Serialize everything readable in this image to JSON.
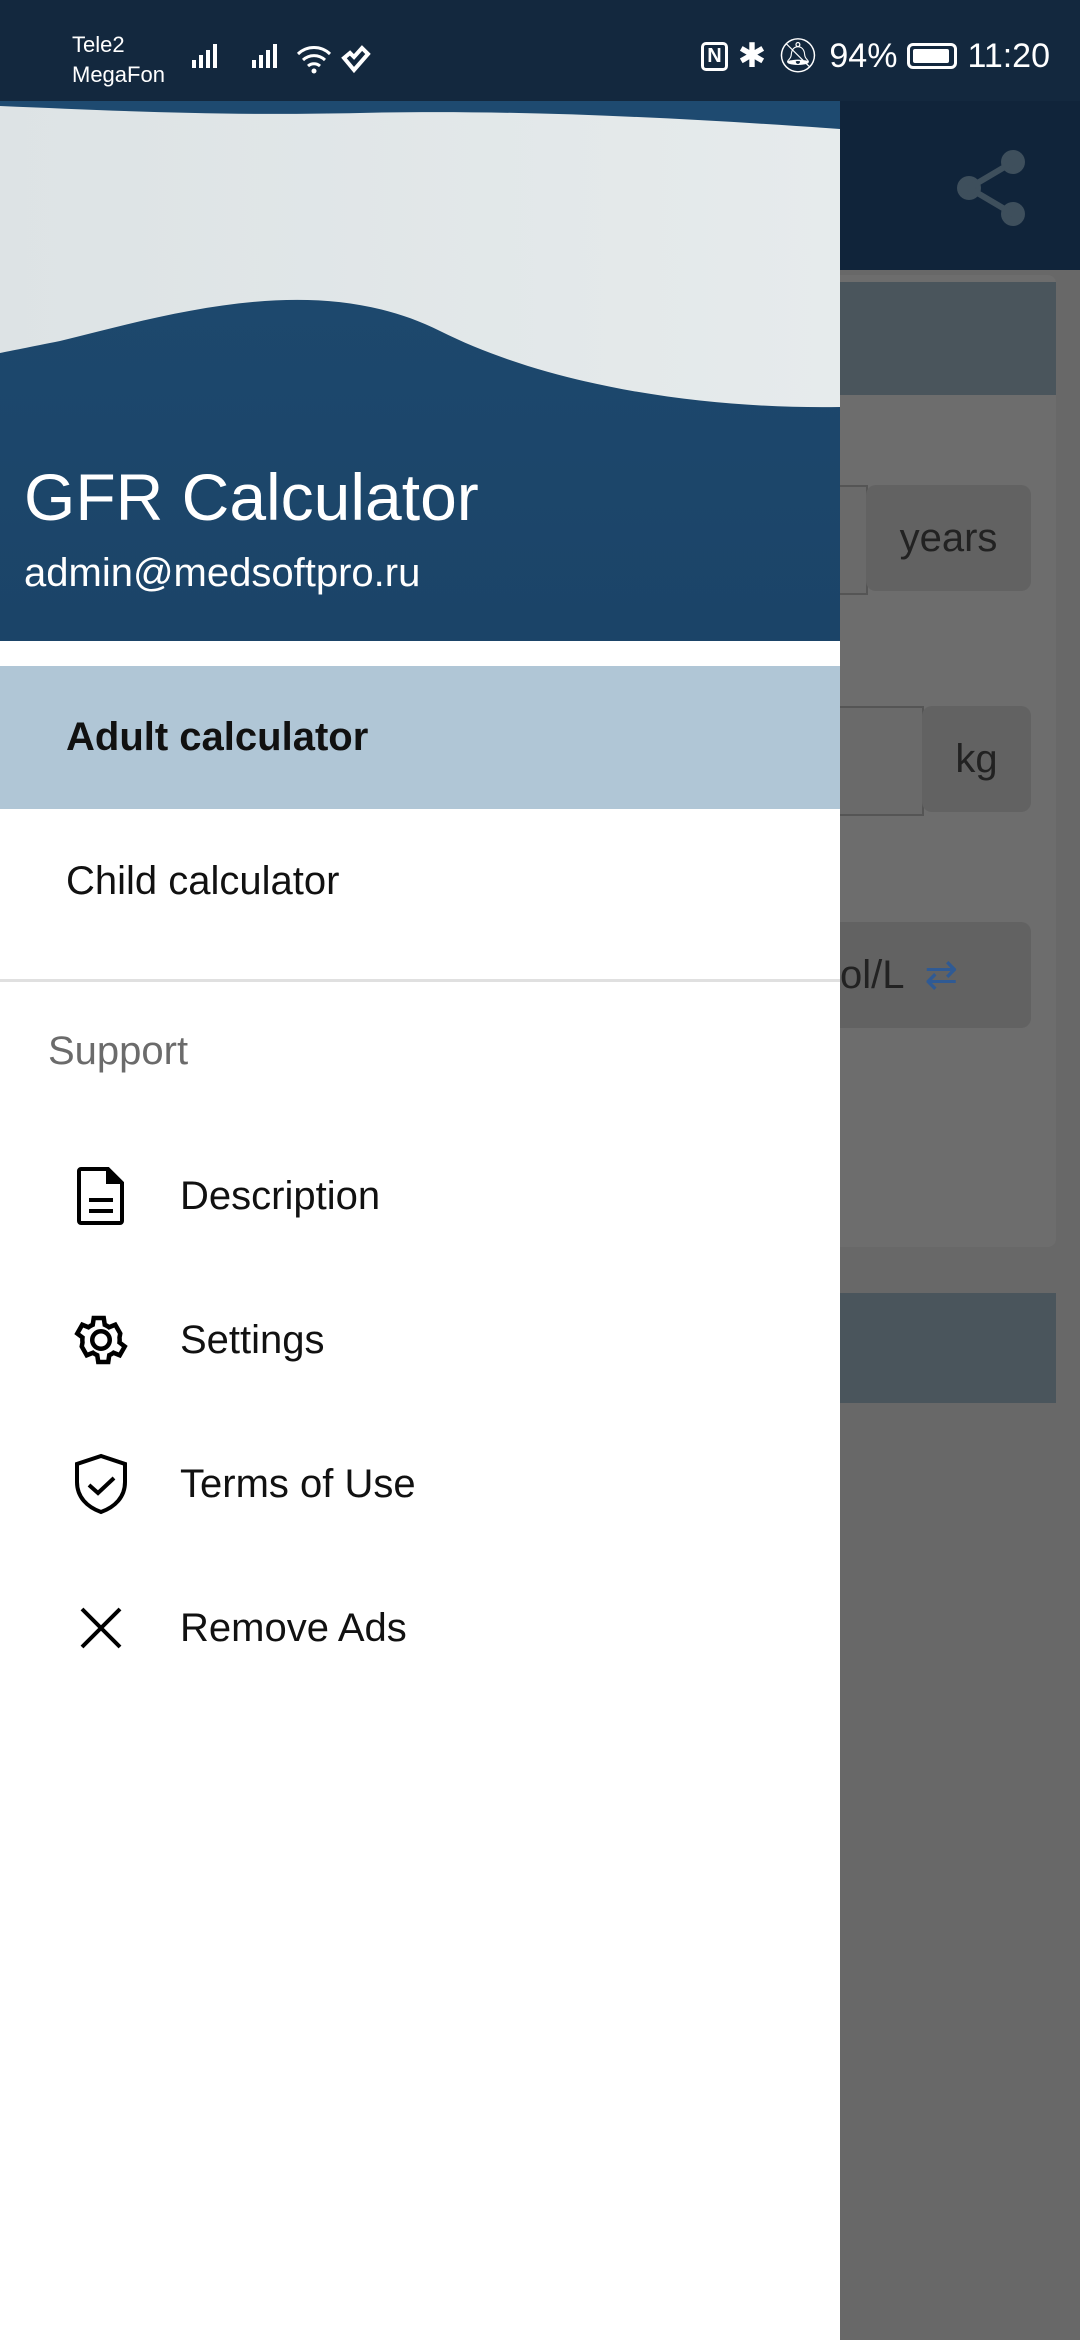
{
  "status_bar": {
    "carrier1": "Tele2",
    "carrier2": "MegaFon",
    "battery": "94%",
    "time": "11:20"
  },
  "background_app": {
    "units": [
      "years",
      "kg",
      "ol/L"
    ],
    "accent": "#2f5a94"
  },
  "drawer": {
    "title": "GFR Calculator",
    "email": "admin@medsoftpro.ru",
    "items": [
      {
        "label": "Adult calculator",
        "selected": true
      },
      {
        "label": "Child calculator",
        "selected": false
      }
    ],
    "section_label": "Support",
    "support_items": [
      {
        "label": "Description",
        "icon": "document-icon"
      },
      {
        "label": "Settings",
        "icon": "gear-icon"
      },
      {
        "label": "Terms of Use",
        "icon": "shield-check-icon"
      },
      {
        "label": "Remove Ads",
        "icon": "close-icon"
      }
    ],
    "selected_color": "#b0c6d6",
    "header_color": "#1e4a70"
  }
}
